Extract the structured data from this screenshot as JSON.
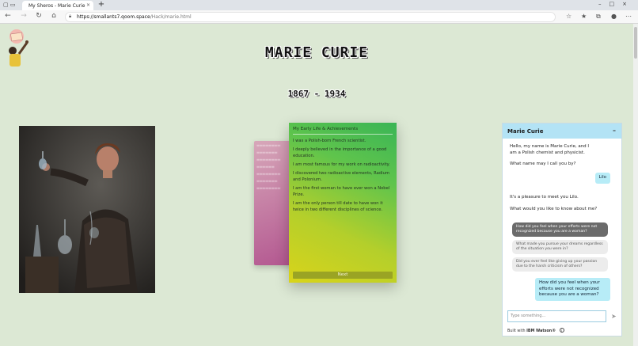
{
  "browser": {
    "tab_title": "My Sheros - Marie Curie",
    "tab_close": "×",
    "new_tab": "+",
    "url_host": "https://smallants7.qoom.space",
    "url_path": "/Hack/marie.html"
  },
  "header": {
    "title": "MARIE CURIE",
    "years": "1867 - 1934"
  },
  "card": {
    "title": "My Early Life & Achievements",
    "items": [
      "I was a Polish-born French scientist.",
      "I deeply believed in the importance of a good education.",
      "I am most famous for my work on radioactivity.",
      "I discovered two radioactive elements, Radium and Polonium.",
      "I am the first woman to have ever won a Nobel Prize.",
      "I am the only person till date to have won it twice in two different disciplines of science."
    ],
    "next_label": "Next"
  },
  "chat": {
    "title": "Marie Curie",
    "minimize": "–",
    "bot_intro": "Hello, my name is Marie Curie, and I am a Polish chemist and physicist.",
    "bot_ask_name": "What name may I call you by?",
    "user_name": "Lilo",
    "bot_greet": "It's a pleasure to meet you Lilo.",
    "bot_ask_topic": "What would you like to know about me?",
    "options": [
      "How did you feel when your efforts were not recognized because you are a woman?",
      "What made you pursue your dreams regardless of the situation you were in?",
      "Did you ever feel like giving up your passion due to the harsh criticism of others?"
    ],
    "user_question": "How did you feel when your efforts were not recognized because you are a woman?",
    "input_placeholder": "Type something...",
    "built_prefix": "Built with",
    "built_brand": "IBM Watson®"
  },
  "colors": {
    "page_bg": "#dce8d4",
    "chat_header": "#b3e3f5",
    "user_bubble": "#b7ecf7",
    "next_button": "#9aa424"
  },
  "icons": [
    "back-arrow-icon",
    "forward-arrow-icon",
    "refresh-icon",
    "home-icon",
    "lock-icon",
    "favorites-icon",
    "collections-icon",
    "profile-icon",
    "menu-icon",
    "send-icon",
    "info-icon"
  ]
}
